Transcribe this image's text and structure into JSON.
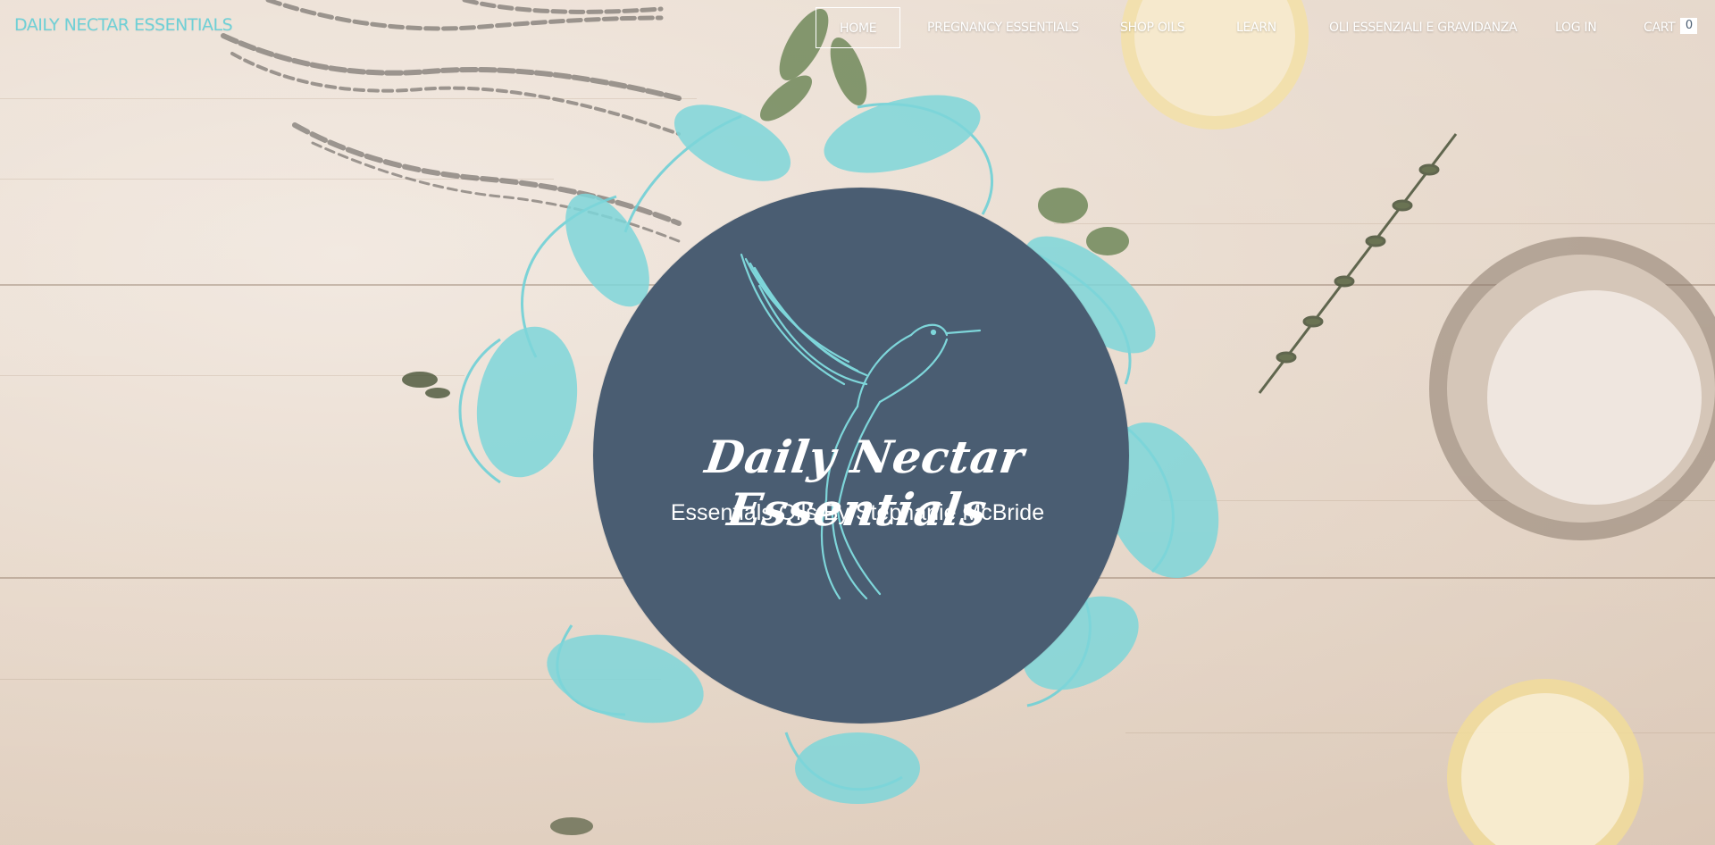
{
  "header": {
    "site_title": "DAILY NECTAR ESSENTIALS"
  },
  "nav": {
    "items": [
      {
        "key": "home",
        "label": "HOME",
        "active": true
      },
      {
        "key": "pregnancy",
        "label": "PREGNANCY ESSENTIALS",
        "active": false
      },
      {
        "key": "shop",
        "label": "SHOP OILS",
        "active": false
      },
      {
        "key": "learn",
        "label": "LEARN",
        "active": false
      },
      {
        "key": "oli",
        "label": "OLI ESSENZIALI E GRAVIDANZA",
        "active": false
      },
      {
        "key": "login",
        "label": "LOG IN",
        "active": false
      }
    ],
    "cart": {
      "label": "CART",
      "count": "0"
    }
  },
  "hero": {
    "brand": "Daily Nectar Essentials",
    "tagline": "Essentials Oils By Stephanie McBride",
    "icon": "hummingbird-icon"
  },
  "colors": {
    "accent": "#6fd0d6",
    "circle": "#4a5d72",
    "nav_text": "#ffffff",
    "background": "#e9ddd2"
  }
}
